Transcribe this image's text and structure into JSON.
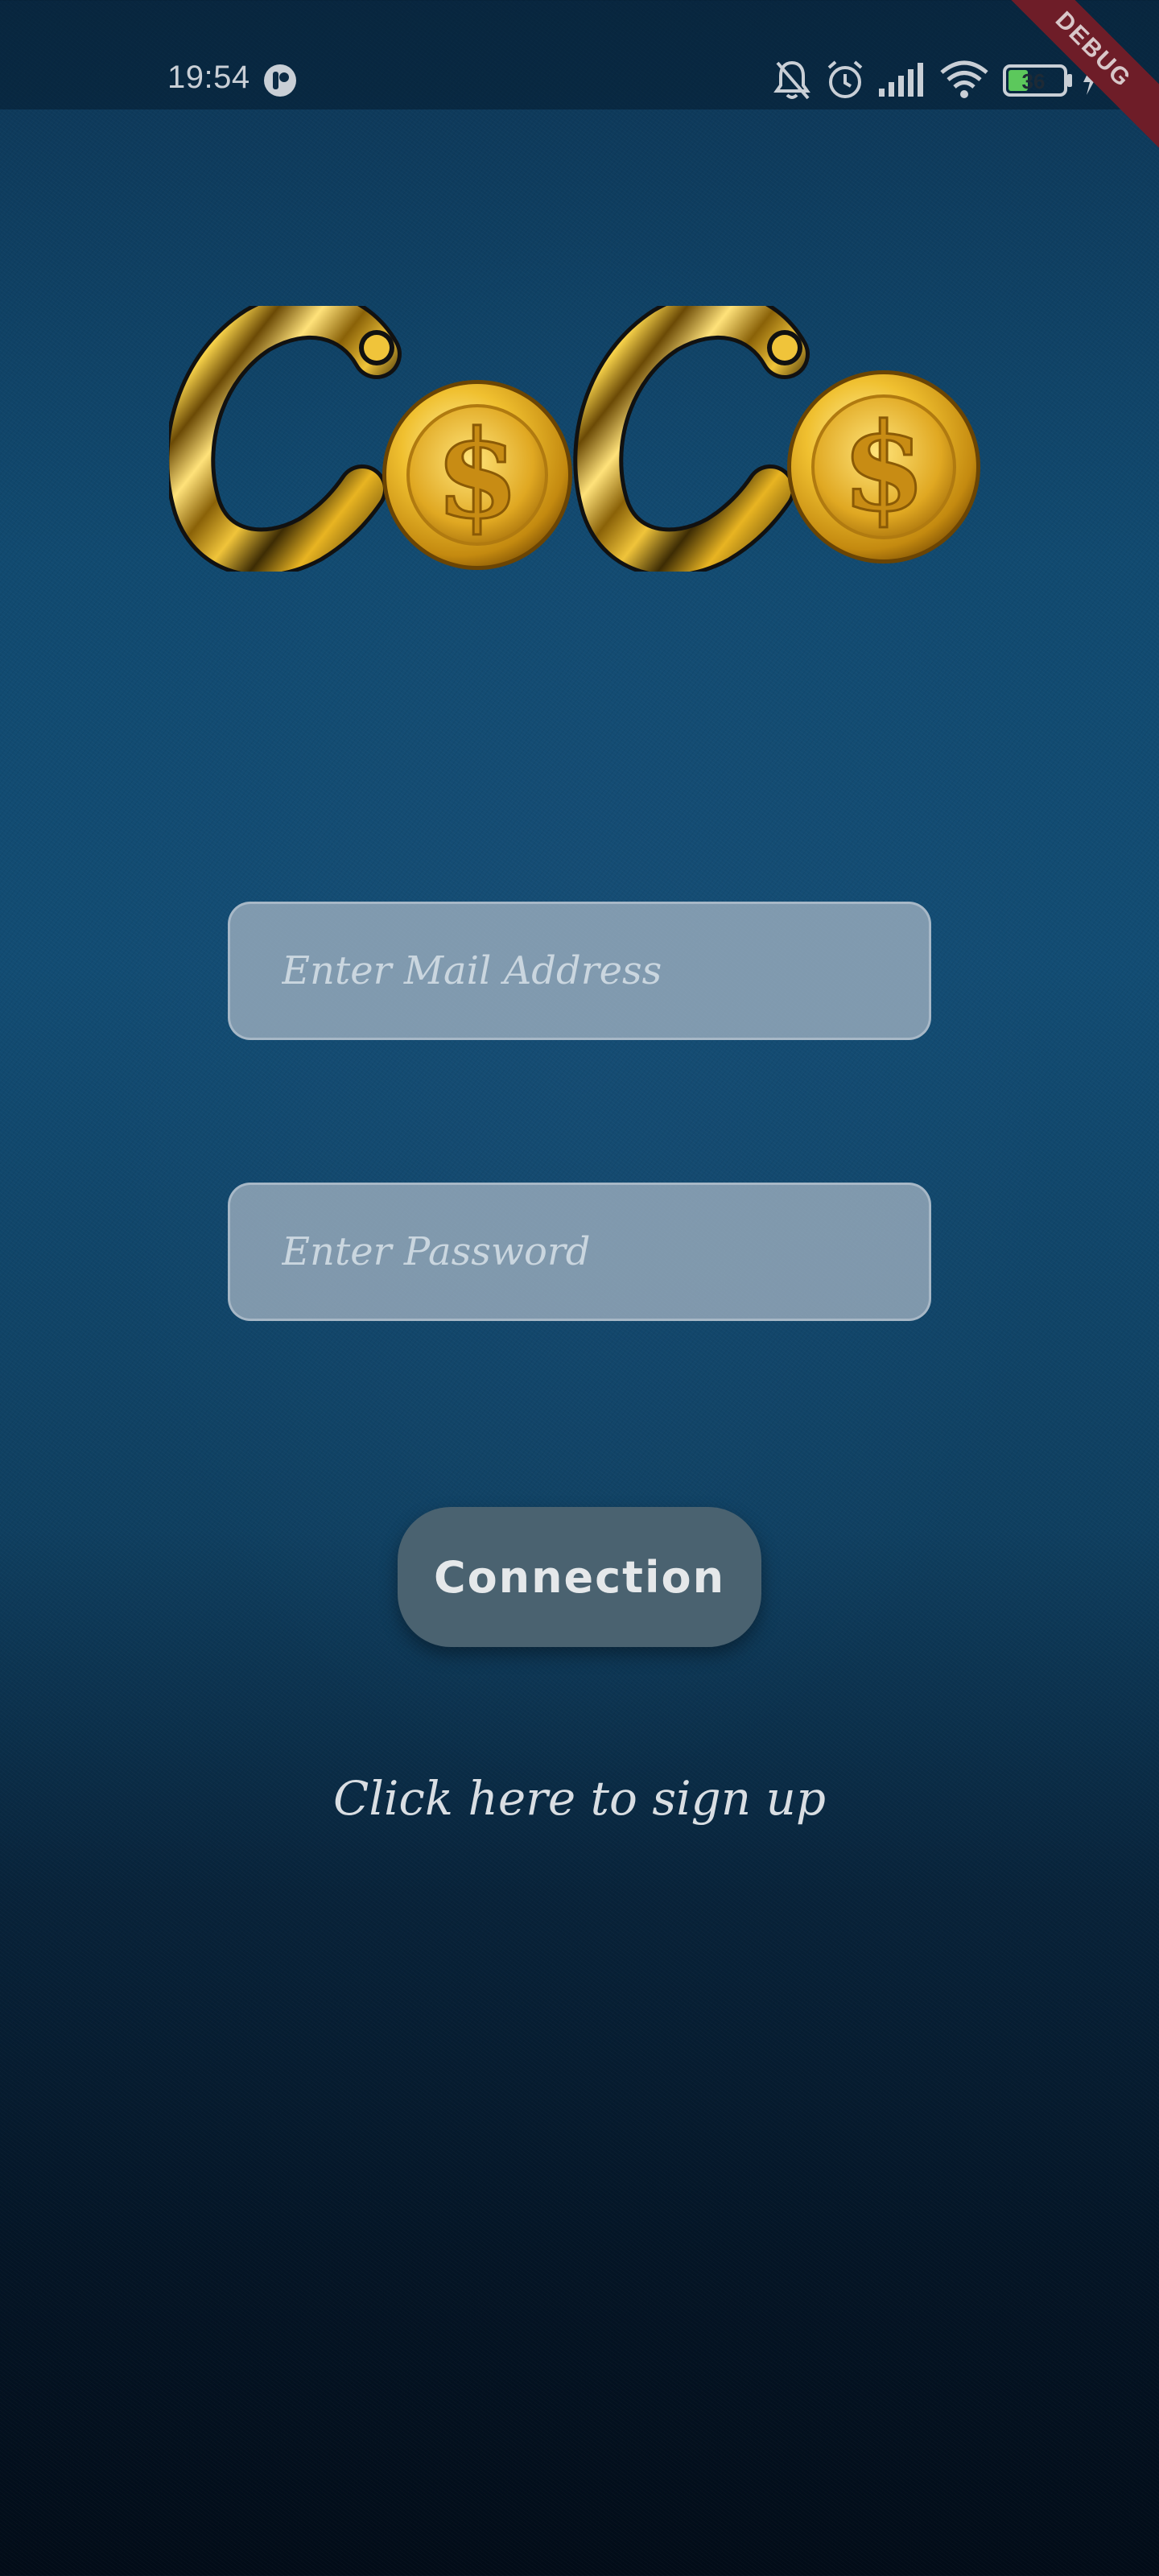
{
  "status_bar": {
    "time": "19:54",
    "battery_level": "36",
    "icons": [
      "notifications-muted-icon",
      "alarm-icon",
      "signal-icon",
      "wifi-icon",
      "battery-icon",
      "charging-icon"
    ]
  },
  "debug_banner": {
    "label": "DEBUG"
  },
  "logo": {
    "text": "CoCo"
  },
  "login_form": {
    "email_placeholder": "Enter Mail Address",
    "email_value": "",
    "password_placeholder": "Enter Password",
    "password_value": "",
    "connect_label": "Connection",
    "signup_link": "Click here to sign up"
  },
  "colors": {
    "background_top": "#114a70",
    "background_bottom": "#020c18",
    "gold": "#e8b422",
    "button": "#4a6270",
    "field": "#aab9c6"
  }
}
